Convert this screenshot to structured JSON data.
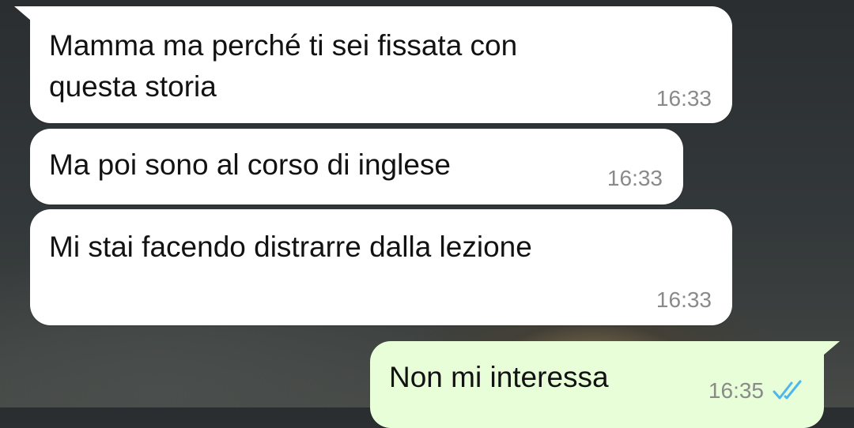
{
  "messages": [
    {
      "direction": "incoming",
      "text": "Mamma ma perché ti sei fissata con\nquesta storia",
      "time": "16:33"
    },
    {
      "direction": "incoming",
      "text": "Ma poi sono al corso di inglese",
      "time": "16:33"
    },
    {
      "direction": "incoming",
      "text": "Mi stai facendo distrarre dalla lezione",
      "time": "16:33"
    },
    {
      "direction": "outgoing",
      "text": "Non mi interessa",
      "time": "16:35",
      "status_icon": "double-check-icon",
      "status": "read"
    }
  ],
  "colors": {
    "incoming_bubble": "#ffffff",
    "outgoing_bubble": "#e7fed8",
    "read_ticks": "#4fb6ec",
    "time_text": "#8a8a8a"
  }
}
